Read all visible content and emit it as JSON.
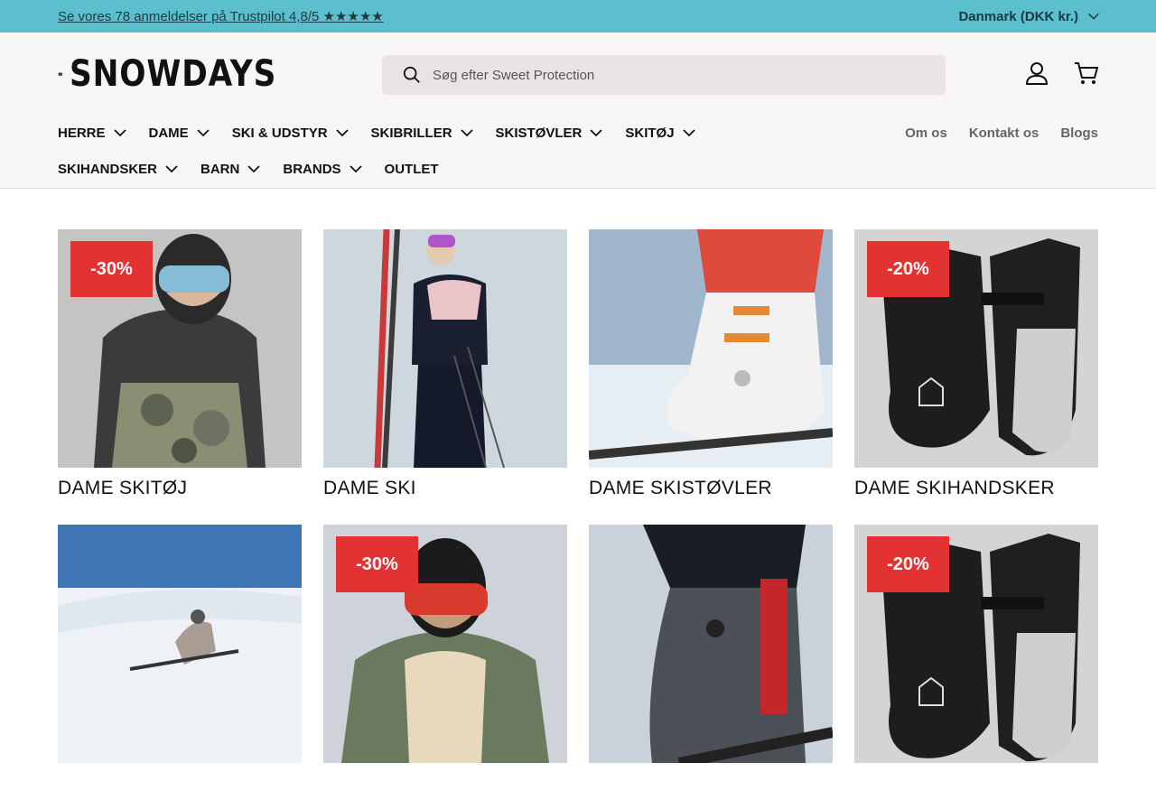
{
  "announcement": {
    "text": "Se vores 78 anmeldelser på Trustpilot 4,8/5 ★★★★★"
  },
  "country_selector": {
    "label": "Danmark (DKK kr.)"
  },
  "logo": {
    "text": "SNOWDAYS"
  },
  "search": {
    "placeholder": "Søg efter Sweet Protection"
  },
  "nav": {
    "main": [
      {
        "label": "HERRE"
      },
      {
        "label": "DAME"
      },
      {
        "label": "SKI & UDSTYR"
      },
      {
        "label": "SKIBRILLER"
      },
      {
        "label": "SKISTØVLER"
      },
      {
        "label": "SKITØJ"
      },
      {
        "label": "SKIHANDSKER"
      },
      {
        "label": "BARN"
      },
      {
        "label": "BRANDS"
      },
      {
        "label": "OUTLET"
      }
    ],
    "secondary": [
      {
        "label": "Om os"
      },
      {
        "label": "Kontakt os"
      },
      {
        "label": "Blogs"
      }
    ]
  },
  "categories": [
    {
      "title": "DAME SKITØJ",
      "badge": "-30%"
    },
    {
      "title": "DAME SKI",
      "badge": ""
    },
    {
      "title": "DAME SKISTØVLER",
      "badge": ""
    },
    {
      "title": "DAME SKIHANDSKER",
      "badge": "-20%"
    },
    {
      "title": "",
      "badge": ""
    },
    {
      "title": "",
      "badge": "-30%"
    },
    {
      "title": "",
      "badge": ""
    },
    {
      "title": "",
      "badge": "-20%"
    }
  ],
  "colors": {
    "topbar": "#5bbfce",
    "header_bg": "#f8f5f5",
    "badge": "#e33232"
  }
}
